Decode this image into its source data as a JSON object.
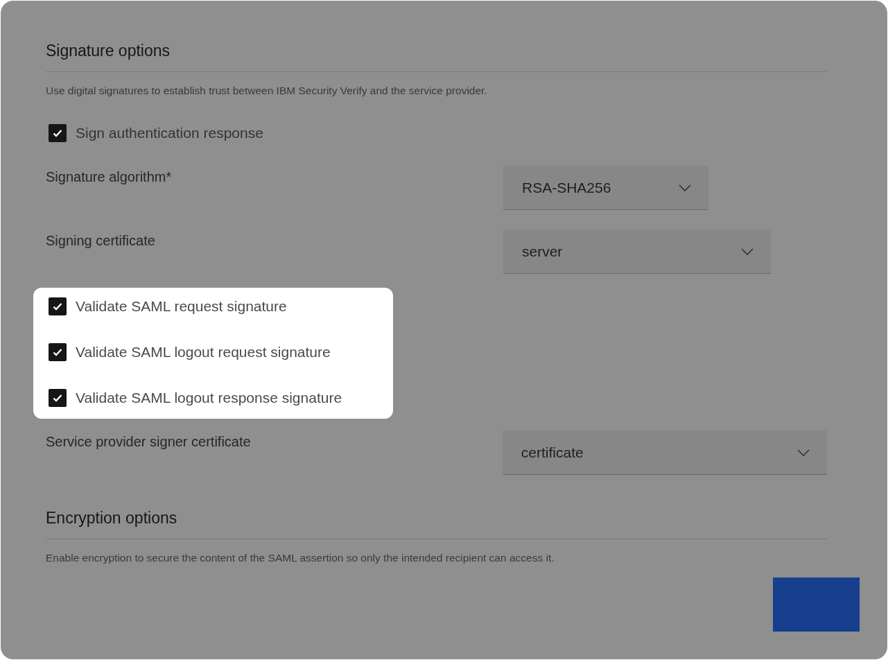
{
  "signature_options": {
    "title": "Signature options",
    "description": "Use digital signatures to establish trust between IBM Security Verify and the service provider.",
    "sign_response": {
      "label": "Sign authentication response",
      "checked": true
    },
    "fields": [
      {
        "label": "Signature algorithm*",
        "value": "RSA-SHA256"
      },
      {
        "label": "Signing certificate",
        "value": "server"
      }
    ],
    "validation_checkboxes": [
      {
        "label": "Validate SAML request signature",
        "checked": true
      },
      {
        "label": "Validate SAML logout request signature",
        "checked": true
      },
      {
        "label": "Validate SAML logout response signature",
        "checked": true
      }
    ],
    "signer_certificate": {
      "label": "Service provider signer certificate",
      "value": "certificate"
    }
  },
  "encryption_options": {
    "title": "Encryption options",
    "description": "Enable encryption to secure the content of the SAML assertion so only the intended recipient can access it."
  }
}
